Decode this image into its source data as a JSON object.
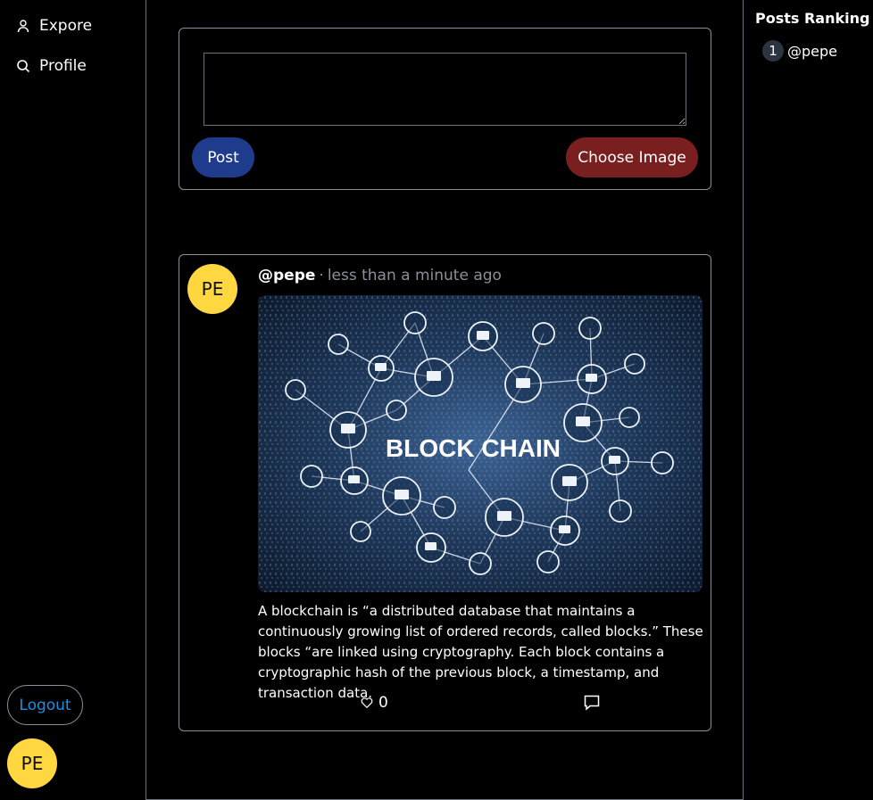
{
  "nav": {
    "items": [
      {
        "label": "Expore",
        "icon": "user-icon"
      },
      {
        "label": "Profile",
        "icon": "search-icon"
      }
    ],
    "logout_label": "Logout",
    "user_initials": "PE"
  },
  "composer": {
    "text_value": "",
    "post_label": "Post",
    "choose_image_label": "Choose Image"
  },
  "post": {
    "avatar_initials": "PE",
    "author": "@pepe",
    "separator": "·",
    "time": "less than a minute ago",
    "image_caption": "BLOCK CHAIN",
    "text": "A blockchain is “a distributed database that maintains a continuously growing list of ordered records, called blocks.” These blocks “are linked using cryptography. Each block contains a cryptographic hash of the previous block, a timestamp, and transaction data.",
    "like_count": "0"
  },
  "ranking": {
    "title": "Posts Ranking",
    "items": [
      {
        "rank": "1",
        "user": "@pepe"
      }
    ]
  },
  "colors": {
    "background": "#000000",
    "post_button": "#1f3b8c",
    "image_button": "#7a1f1f",
    "avatar": "#ffd740",
    "logout_text": "#1d8fe0",
    "border": "#8a8f99"
  }
}
